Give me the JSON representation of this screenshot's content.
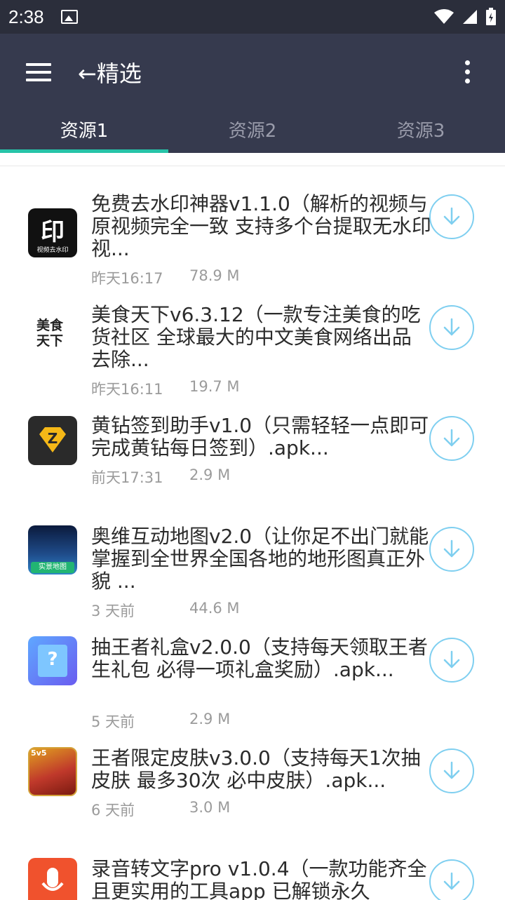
{
  "status": {
    "time": "2:38"
  },
  "appbar": {
    "title": "←精选"
  },
  "tabs": [
    {
      "label": "资源1"
    },
    {
      "label": "资源2"
    },
    {
      "label": "资源3"
    }
  ],
  "items": [
    {
      "title": "免费去水印神器v1.1.0（解析的视频与原视频完全一致 支持多个台提取无水印视...",
      "date": "昨天16:17",
      "size": "78.9 M",
      "icon": "video-watermark-icon",
      "icon_text": "印",
      "icon_subtext": "视频去水印"
    },
    {
      "title": "美食天下v6.3.12（一款专注美食的吃货社区 全球最大的中文美食网络出品 去除...",
      "date": "昨天16:11",
      "size": "19.7 M",
      "icon": "meishi-icon",
      "icon_text": "美食天下"
    },
    {
      "title": "黄钻签到助手v1.0（只需轻轻一点即可完成黄钻每日签到）.apk...",
      "date": "前天17:31",
      "size": "2.9 M",
      "icon": "yellow-diamond-icon",
      "icon_text": "Z"
    },
    {
      "title": "奥维互动地图v2.0（让你足不出门就能掌握到全世界全国各地的地形图真正外貌 ...",
      "date": "3 天前",
      "size": "44.6 M",
      "icon": "map-earth-icon",
      "icon_text": "实景地图"
    },
    {
      "title": "抽王者礼盒v2.0.0（支持每天领取王者生礼包 必得一项礼盒奖励）.apk...",
      "date": "5 天前",
      "size": "2.9 M",
      "icon": "gift-box-icon",
      "icon_text": "?"
    },
    {
      "title": "王者限定皮肤v3.0.0（支持每天1次抽皮肤 最多30次 必中皮肤）.apk...",
      "date": "6 天前",
      "size": "3.0 M",
      "icon": "game-hero-icon",
      "icon_text": "5v5"
    },
    {
      "title": "录音转文字pro v1.0.4（一款功能齐全且更实用的工具app 已解锁永久",
      "date": "",
      "size": "",
      "icon": "microphone-icon",
      "icon_text": ""
    }
  ],
  "colors": {
    "statusbar": "#2b2e3b",
    "appbar": "#363a4e",
    "indicator": "#27c3a8",
    "download": "#7fcff0"
  }
}
